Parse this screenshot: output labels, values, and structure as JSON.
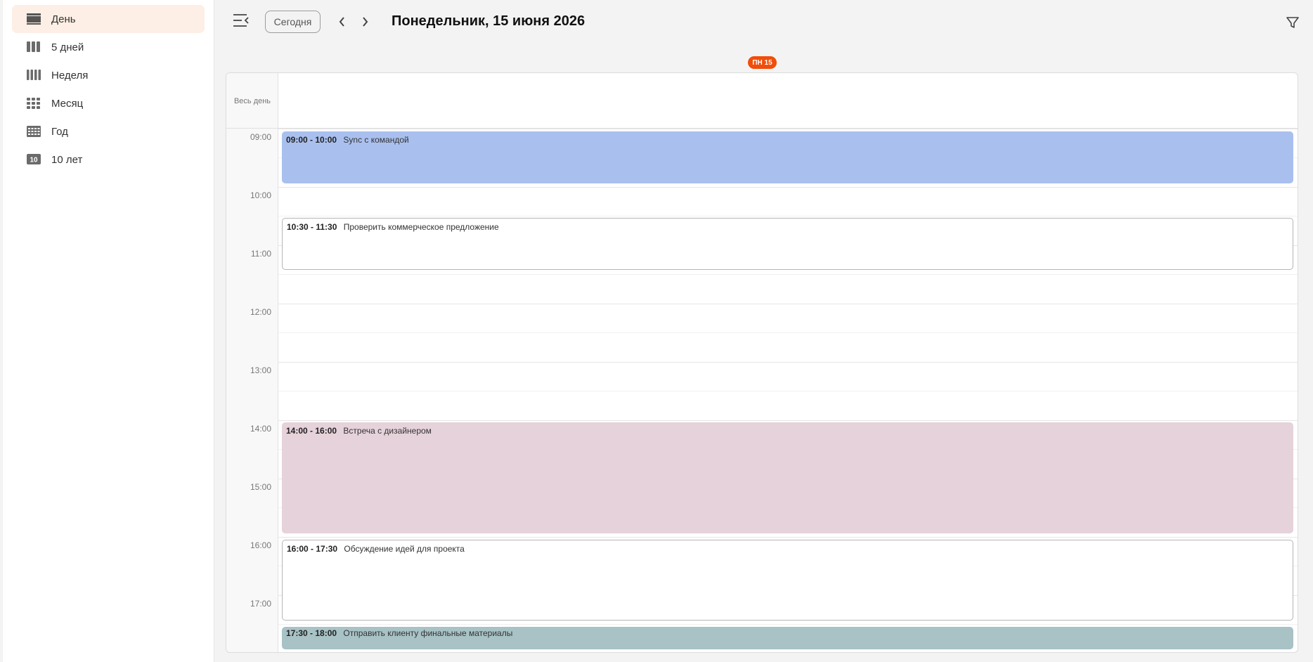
{
  "sidebar": {
    "items": [
      {
        "label": "День",
        "icon": "day-view-icon",
        "active": true
      },
      {
        "label": "5 дней",
        "icon": "five-days-view-icon",
        "active": false
      },
      {
        "label": "Неделя",
        "icon": "week-view-icon",
        "active": false
      },
      {
        "label": "Месяц",
        "icon": "month-view-icon",
        "active": false
      },
      {
        "label": "Год",
        "icon": "year-view-icon",
        "active": false
      },
      {
        "label": "10 лет",
        "icon": "decade-view-icon",
        "badge": "10",
        "active": false
      }
    ]
  },
  "toolbar": {
    "menu_icon": "collapse-menu-icon",
    "today_label": "Сегодня",
    "prev_icon": "chevron-left-icon",
    "next_icon": "chevron-right-icon",
    "date_title": "Понедельник, 15 июня 2026",
    "filter_icon": "filter-icon"
  },
  "day_badge": "ПН 15",
  "calendar": {
    "allday_label": "Весь день",
    "hours": [
      "09:00",
      "10:00",
      "11:00",
      "12:00",
      "13:00",
      "14:00",
      "15:00",
      "16:00",
      "17:00"
    ],
    "events": [
      {
        "time": "09:00 - 10:00",
        "title": "Sync с командой",
        "color": "#a9c0ef"
      },
      {
        "time": "10:30 - 11:30",
        "title": "Проверить коммерческое предложение",
        "color": "#ffffff"
      },
      {
        "time": "14:00 - 16:00",
        "title": "Встреча с дизайнером",
        "color": "#e6d2da"
      },
      {
        "time": "16:00 - 17:30",
        "title": "Обсуждение идей для проекта",
        "color": "#ffffff"
      },
      {
        "time": "17:30 - 18:00",
        "title": "Отправить клиенту финальные материалы",
        "color": "#a8c2c6"
      }
    ]
  },
  "colors": {
    "accent": "#f04e0a",
    "active_item_bg": "#fdefe5"
  }
}
